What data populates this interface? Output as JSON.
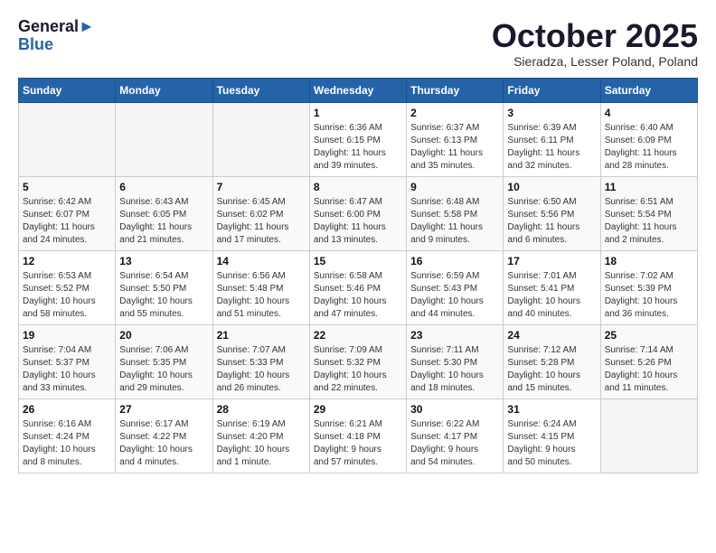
{
  "header": {
    "logo": {
      "line1": "General",
      "line2": "Blue"
    },
    "title": "October 2025",
    "location": "Sieradza, Lesser Poland, Poland"
  },
  "weekdays": [
    "Sunday",
    "Monday",
    "Tuesday",
    "Wednesday",
    "Thursday",
    "Friday",
    "Saturday"
  ],
  "weeks": [
    [
      {
        "day": null,
        "info": null
      },
      {
        "day": null,
        "info": null
      },
      {
        "day": null,
        "info": null
      },
      {
        "day": "1",
        "info": "Sunrise: 6:36 AM\nSunset: 6:15 PM\nDaylight: 11 hours\nand 39 minutes."
      },
      {
        "day": "2",
        "info": "Sunrise: 6:37 AM\nSunset: 6:13 PM\nDaylight: 11 hours\nand 35 minutes."
      },
      {
        "day": "3",
        "info": "Sunrise: 6:39 AM\nSunset: 6:11 PM\nDaylight: 11 hours\nand 32 minutes."
      },
      {
        "day": "4",
        "info": "Sunrise: 6:40 AM\nSunset: 6:09 PM\nDaylight: 11 hours\nand 28 minutes."
      }
    ],
    [
      {
        "day": "5",
        "info": "Sunrise: 6:42 AM\nSunset: 6:07 PM\nDaylight: 11 hours\nand 24 minutes."
      },
      {
        "day": "6",
        "info": "Sunrise: 6:43 AM\nSunset: 6:05 PM\nDaylight: 11 hours\nand 21 minutes."
      },
      {
        "day": "7",
        "info": "Sunrise: 6:45 AM\nSunset: 6:02 PM\nDaylight: 11 hours\nand 17 minutes."
      },
      {
        "day": "8",
        "info": "Sunrise: 6:47 AM\nSunset: 6:00 PM\nDaylight: 11 hours\nand 13 minutes."
      },
      {
        "day": "9",
        "info": "Sunrise: 6:48 AM\nSunset: 5:58 PM\nDaylight: 11 hours\nand 9 minutes."
      },
      {
        "day": "10",
        "info": "Sunrise: 6:50 AM\nSunset: 5:56 PM\nDaylight: 11 hours\nand 6 minutes."
      },
      {
        "day": "11",
        "info": "Sunrise: 6:51 AM\nSunset: 5:54 PM\nDaylight: 11 hours\nand 2 minutes."
      }
    ],
    [
      {
        "day": "12",
        "info": "Sunrise: 6:53 AM\nSunset: 5:52 PM\nDaylight: 10 hours\nand 58 minutes."
      },
      {
        "day": "13",
        "info": "Sunrise: 6:54 AM\nSunset: 5:50 PM\nDaylight: 10 hours\nand 55 minutes."
      },
      {
        "day": "14",
        "info": "Sunrise: 6:56 AM\nSunset: 5:48 PM\nDaylight: 10 hours\nand 51 minutes."
      },
      {
        "day": "15",
        "info": "Sunrise: 6:58 AM\nSunset: 5:46 PM\nDaylight: 10 hours\nand 47 minutes."
      },
      {
        "day": "16",
        "info": "Sunrise: 6:59 AM\nSunset: 5:43 PM\nDaylight: 10 hours\nand 44 minutes."
      },
      {
        "day": "17",
        "info": "Sunrise: 7:01 AM\nSunset: 5:41 PM\nDaylight: 10 hours\nand 40 minutes."
      },
      {
        "day": "18",
        "info": "Sunrise: 7:02 AM\nSunset: 5:39 PM\nDaylight: 10 hours\nand 36 minutes."
      }
    ],
    [
      {
        "day": "19",
        "info": "Sunrise: 7:04 AM\nSunset: 5:37 PM\nDaylight: 10 hours\nand 33 minutes."
      },
      {
        "day": "20",
        "info": "Sunrise: 7:06 AM\nSunset: 5:35 PM\nDaylight: 10 hours\nand 29 minutes."
      },
      {
        "day": "21",
        "info": "Sunrise: 7:07 AM\nSunset: 5:33 PM\nDaylight: 10 hours\nand 26 minutes."
      },
      {
        "day": "22",
        "info": "Sunrise: 7:09 AM\nSunset: 5:32 PM\nDaylight: 10 hours\nand 22 minutes."
      },
      {
        "day": "23",
        "info": "Sunrise: 7:11 AM\nSunset: 5:30 PM\nDaylight: 10 hours\nand 18 minutes."
      },
      {
        "day": "24",
        "info": "Sunrise: 7:12 AM\nSunset: 5:28 PM\nDaylight: 10 hours\nand 15 minutes."
      },
      {
        "day": "25",
        "info": "Sunrise: 7:14 AM\nSunset: 5:26 PM\nDaylight: 10 hours\nand 11 minutes."
      }
    ],
    [
      {
        "day": "26",
        "info": "Sunrise: 6:16 AM\nSunset: 4:24 PM\nDaylight: 10 hours\nand 8 minutes."
      },
      {
        "day": "27",
        "info": "Sunrise: 6:17 AM\nSunset: 4:22 PM\nDaylight: 10 hours\nand 4 minutes."
      },
      {
        "day": "28",
        "info": "Sunrise: 6:19 AM\nSunset: 4:20 PM\nDaylight: 10 hours\nand 1 minute."
      },
      {
        "day": "29",
        "info": "Sunrise: 6:21 AM\nSunset: 4:18 PM\nDaylight: 9 hours\nand 57 minutes."
      },
      {
        "day": "30",
        "info": "Sunrise: 6:22 AM\nSunset: 4:17 PM\nDaylight: 9 hours\nand 54 minutes."
      },
      {
        "day": "31",
        "info": "Sunrise: 6:24 AM\nSunset: 4:15 PM\nDaylight: 9 hours\nand 50 minutes."
      },
      {
        "day": null,
        "info": null
      }
    ]
  ]
}
